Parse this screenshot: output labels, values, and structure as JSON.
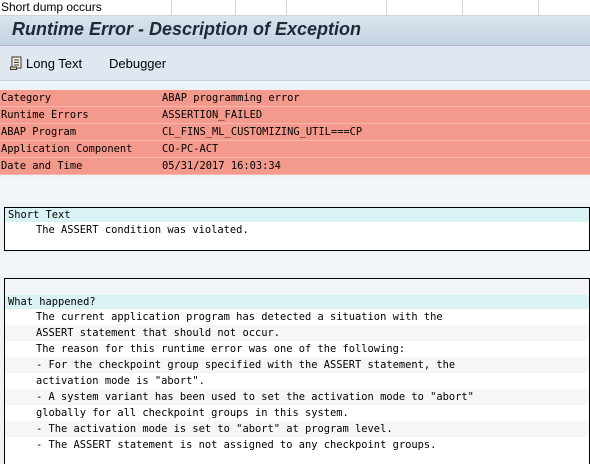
{
  "tab": {
    "title": "Short dump occurs"
  },
  "window": {
    "title": "Runtime Error - Description of Exception"
  },
  "toolbar": {
    "long_text": "Long Text",
    "debugger": "Debugger"
  },
  "header": {
    "rows": [
      {
        "key": "Category",
        "value": "ABAP programming error"
      },
      {
        "key": "Runtime Errors",
        "value": "ASSERTION_FAILED"
      },
      {
        "key": "ABAP Program",
        "value": "CL_FINS_ML_CUSTOMIZING_UTIL===CP"
      },
      {
        "key": "Application Component",
        "value": "CO-PC-ACT"
      },
      {
        "key": "Date and Time",
        "value": "05/31/2017 16:03:34"
      }
    ]
  },
  "short_text": {
    "heading": "Short Text",
    "lines": [
      "The ASSERT condition was violated."
    ]
  },
  "what_happened": {
    "heading": "What happened?",
    "lines": [
      "The current application program has detected a situation with the",
      "ASSERT statement that should not occur.",
      "The reason for this runtime error was one of the following:",
      "- For the checkpoint group specified with the ASSERT statement, the",
      "activation mode is \"abort\".",
      "- A system variant has been used to set the activation mode to \"abort\"",
      "globally for all checkpoint groups in this system.",
      "- The activation mode is set to \"abort\" at program level.",
      "- The ASSERT statement is not assigned to any checkpoint groups."
    ]
  },
  "colors": {
    "header_bg": "#f49a8c",
    "section_head_bg": "#d9f2f3",
    "titlebar": "#c3d3e1"
  }
}
